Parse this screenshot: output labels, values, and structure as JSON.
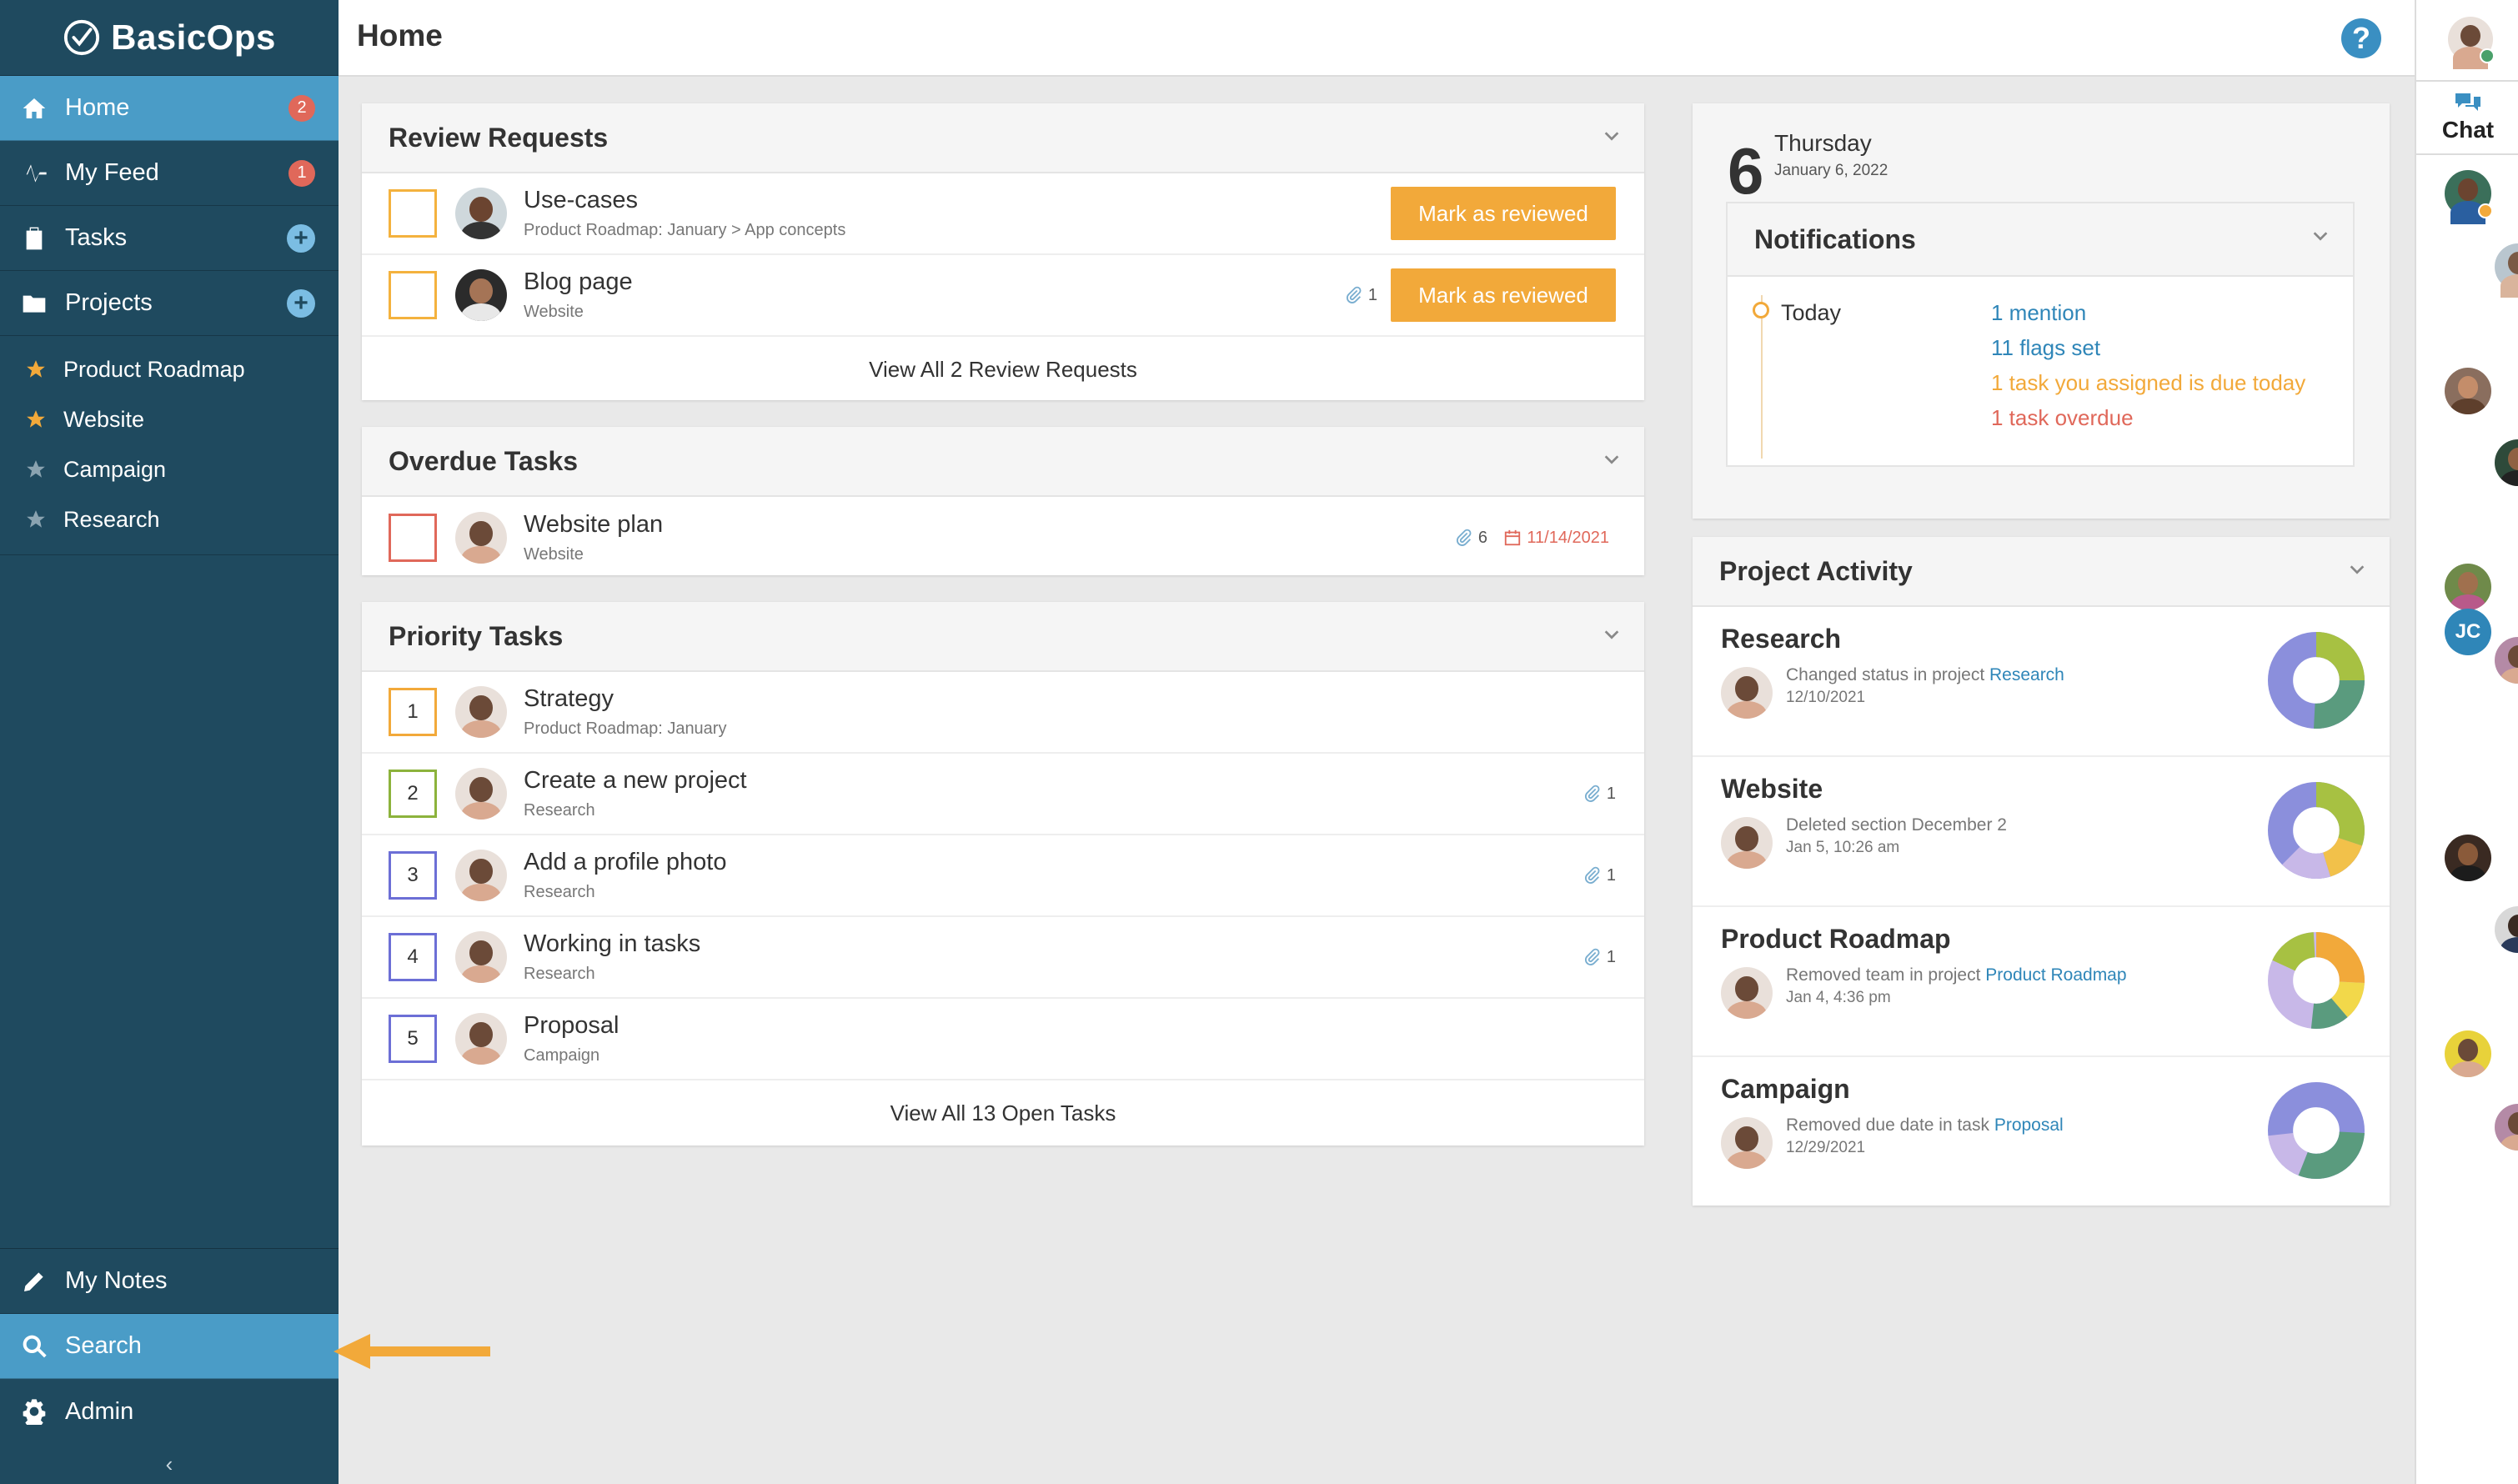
{
  "app": {
    "name": "BasicOps",
    "page_title": "Home",
    "help_label": "?"
  },
  "colors": {
    "sidebar": "#1f4a5f",
    "active": "#4a9cc7",
    "accent": "#f2a93a",
    "link": "#2f86b8",
    "danger": "#e0685a"
  },
  "sidebar": {
    "nav": [
      {
        "label": "Home",
        "badge": "2",
        "icon": "home-icon"
      },
      {
        "label": "My Feed",
        "badge": "1",
        "icon": "pulse-icon"
      },
      {
        "label": "Tasks",
        "icon": "clipboard-icon",
        "action": "+"
      },
      {
        "label": "Projects",
        "icon": "folder-icon",
        "action": "+"
      }
    ],
    "projects": [
      {
        "label": "Product Roadmap",
        "starred": true
      },
      {
        "label": "Website",
        "starred": true
      },
      {
        "label": "Campaign",
        "starred": false
      },
      {
        "label": "Research",
        "starred": false
      }
    ],
    "bottom": [
      {
        "label": "My Notes",
        "icon": "pencil-icon"
      },
      {
        "label": "Search",
        "icon": "search-icon"
      },
      {
        "label": "Admin",
        "icon": "gear-icon"
      }
    ],
    "collapse": "‹"
  },
  "review": {
    "title": "Review Requests",
    "items": [
      {
        "name": "Use-cases",
        "sub": "Product Roadmap: January  >  App concepts",
        "button": "Mark as reviewed"
      },
      {
        "name": "Blog page",
        "sub": "Website",
        "attachments": "1",
        "button": "Mark as reviewed"
      }
    ],
    "view_all": "View All 2 Review Requests"
  },
  "overdue": {
    "title": "Overdue Tasks",
    "items": [
      {
        "name": "Website plan",
        "sub": "Website",
        "attachments": "6",
        "date": "11/14/2021"
      }
    ]
  },
  "priority": {
    "title": "Priority Tasks",
    "items": [
      {
        "num": "1",
        "name": "Strategy",
        "sub": "Product Roadmap: January",
        "color": "#f2a93a"
      },
      {
        "num": "2",
        "name": "Create a new project",
        "sub": "Research",
        "attachments": "1",
        "color": "#8cb33c"
      },
      {
        "num": "3",
        "name": "Add a profile photo",
        "sub": "Research",
        "attachments": "1",
        "color": "#6c6fd6"
      },
      {
        "num": "4",
        "name": "Working in tasks",
        "sub": "Research",
        "attachments": "1",
        "color": "#6c6fd6"
      },
      {
        "num": "5",
        "name": "Proposal",
        "sub": "Campaign",
        "color": "#6c6fd6"
      }
    ],
    "view_all": "View All 13 Open Tasks"
  },
  "calendar": {
    "day_num": "6",
    "weekday": "Thursday",
    "full_date": "January 6, 2022"
  },
  "notifications": {
    "title": "Notifications",
    "group": "Today",
    "items": [
      {
        "text": "1 mention",
        "color": "blue"
      },
      {
        "text": "11 flags set",
        "color": "blue"
      },
      {
        "text": "1 task you assigned is due today",
        "color": "orange"
      },
      {
        "text": "1 task overdue",
        "color": "red"
      }
    ]
  },
  "activity": {
    "title": "Project Activity",
    "items": [
      {
        "project": "Research",
        "desc": "Changed status in project ",
        "link": "Research",
        "when": "12/10/2021"
      },
      {
        "project": "Website",
        "desc": "Deleted section December 2",
        "link": "",
        "when": "Jan 5, 10:26 am"
      },
      {
        "project": "Product Roadmap",
        "desc": "Removed team in project ",
        "link": "Product Roadmap",
        "when": "Jan 4, 4:36 pm"
      },
      {
        "project": "Campaign",
        "desc": "Removed due date in task ",
        "link": "Proposal",
        "when": "12/29/2021"
      }
    ]
  },
  "chat": {
    "label": "Chat",
    "initials_avatar": "JC"
  }
}
